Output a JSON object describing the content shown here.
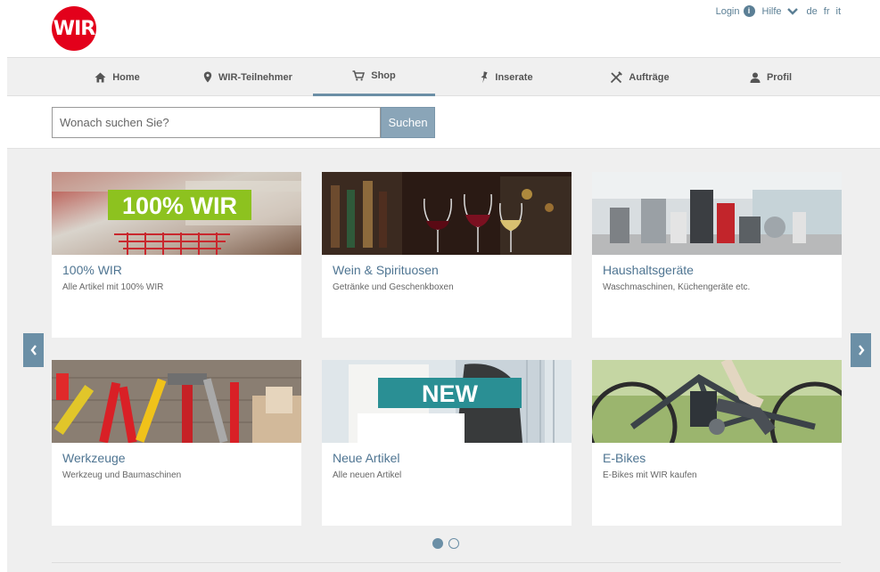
{
  "header": {
    "logo_text": "WIR",
    "login": "Login",
    "help": "Hilfe",
    "languages": [
      "de",
      "fr",
      "it"
    ]
  },
  "nav": {
    "items": [
      {
        "label": "Home",
        "icon": "home-icon"
      },
      {
        "label": "WIR-Teilnehmer",
        "icon": "map-pin-icon"
      },
      {
        "label": "Shop",
        "icon": "cart-icon",
        "active": true
      },
      {
        "label": "Inserate",
        "icon": "pushpin-icon"
      },
      {
        "label": "Aufträge",
        "icon": "tools-icon"
      },
      {
        "label": "Profil",
        "icon": "user-icon"
      }
    ]
  },
  "search": {
    "placeholder": "Wonach suchen Sie?",
    "button": "Suchen"
  },
  "cards": [
    {
      "title": "100% WIR",
      "subtitle": "Alle Artikel mit 100% WIR",
      "banner": "100% WIR"
    },
    {
      "title": "Wein & Spirituosen",
      "subtitle": "Getränke und Geschenkboxen"
    },
    {
      "title": "Haushaltsgeräte",
      "subtitle": "Waschmaschinen, Küchengeräte etc."
    },
    {
      "title": "Werkzeuge",
      "subtitle": "Werkzeug und Baumaschinen"
    },
    {
      "title": "Neue Artikel",
      "subtitle": "Alle neuen Artikel",
      "banner": "NEW"
    },
    {
      "title": "E-Bikes",
      "subtitle": "E-Bikes mit WIR kaufen"
    }
  ],
  "carousel": {
    "pages": 2,
    "current": 1
  },
  "colors": {
    "accent": "#6b8fa6",
    "brand": "#e3001b",
    "banner_green": "#8dc21f",
    "banner_teal": "#2a8f94"
  }
}
